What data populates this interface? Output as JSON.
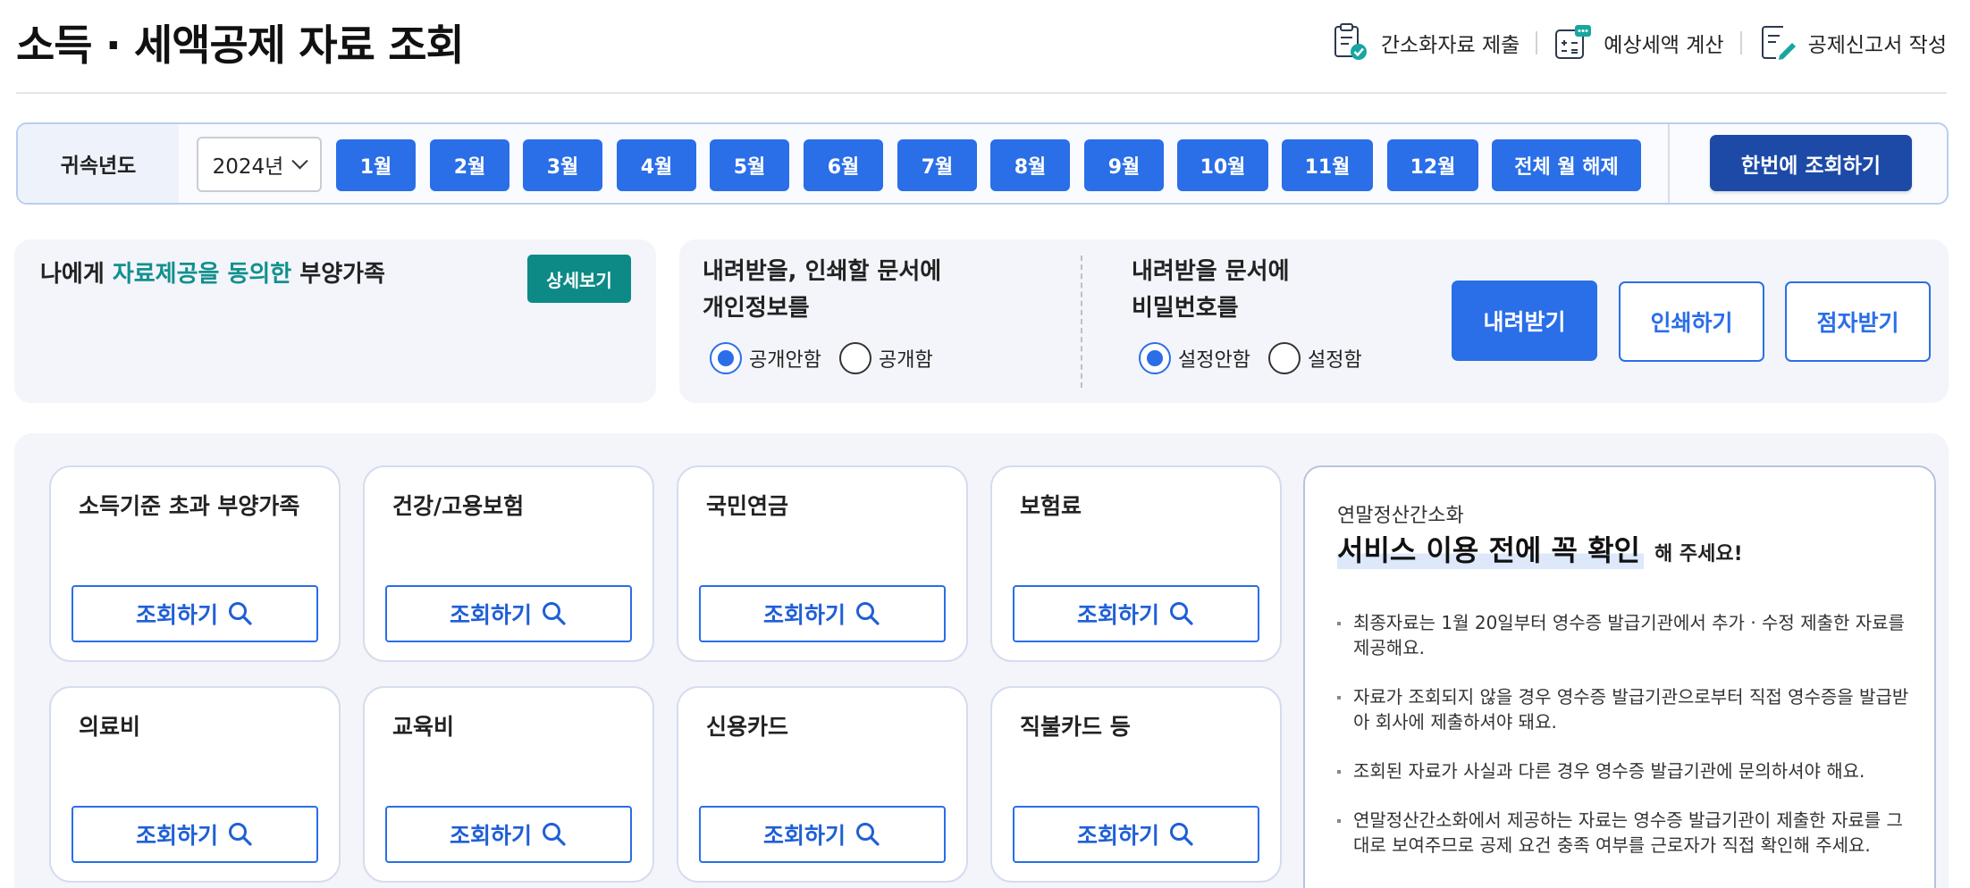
{
  "header": {
    "title": "소득 · 세액공제 자료 조회",
    "actions": [
      {
        "label": "간소화자료 제출",
        "icon": "document-check-icon"
      },
      {
        "label": "예상세액 계산",
        "icon": "calculator-icon"
      },
      {
        "label": "공제신고서 작성",
        "icon": "document-edit-icon"
      }
    ]
  },
  "filter": {
    "year_label": "귀속년도",
    "year_value": "2024년",
    "months": [
      "1월",
      "2월",
      "3월",
      "4월",
      "5월",
      "6월",
      "7월",
      "8월",
      "9월",
      "10월",
      "11월",
      "12월"
    ],
    "clear_all_label": "전체 월 해제",
    "lookup_all_label": "한번에 조회하기"
  },
  "consent": {
    "title_prefix": "나에게 ",
    "title_highlight": "자료제공을 동의한",
    "title_suffix": " 부양가족",
    "detail_label": "상세보기"
  },
  "privacy_option": {
    "title_line1": "내려받을, 인쇄할 문서에",
    "title_line2": "개인정보를",
    "options": [
      "공개안함",
      "공개함"
    ],
    "selected": "공개안함"
  },
  "password_option": {
    "title_line1": "내려받을 문서에",
    "title_line2": "비밀번호를",
    "options": [
      "설정안함",
      "설정함"
    ],
    "selected": "설정안함"
  },
  "doc_actions": {
    "download_label": "내려받기",
    "print_label": "인쇄하기",
    "braille_label": "점자받기"
  },
  "categories": [
    {
      "title": "소득기준 초과 부양가족",
      "button": "조회하기"
    },
    {
      "title": "건강/고용보험",
      "button": "조회하기"
    },
    {
      "title": "국민연금",
      "button": "조회하기"
    },
    {
      "title": "보험료",
      "button": "조회하기"
    },
    {
      "title": "의료비",
      "button": "조회하기"
    },
    {
      "title": "교육비",
      "button": "조회하기"
    },
    {
      "title": "신용카드",
      "button": "조회하기"
    },
    {
      "title": "직불카드 등",
      "button": "조회하기"
    }
  ],
  "notice": {
    "subtitle": "연말정산간소화",
    "title": "서비스 이용 전에 꼭 확인",
    "title_suffix": "해 주세요!",
    "items": [
      "최종자료는 1월 20일부터 영수증 발급기관에서 추가 · 수정 제출한 자료를 제공해요.",
      "자료가 조회되지 않을 경우 영수증 발급기관으로부터 직접 영수증을 발급받아 회사에 제출하셔야 돼요.",
      "조회된 자료가 사실과 다른 경우 영수증 발급기관에 문의하셔야 해요.",
      "연말정산간소화에서 제공하는 자료는 영수증 발급기관이 제출한 자료를 그대로 보여주므로 공제 요건 충족 여부를 근로자가 직접 확인해 주세요."
    ]
  },
  "colors": {
    "primary": "#2a6ee8",
    "primary_dark": "#1d4aa6",
    "teal": "#0d8a86",
    "panel_bg": "#f3f5fa"
  }
}
